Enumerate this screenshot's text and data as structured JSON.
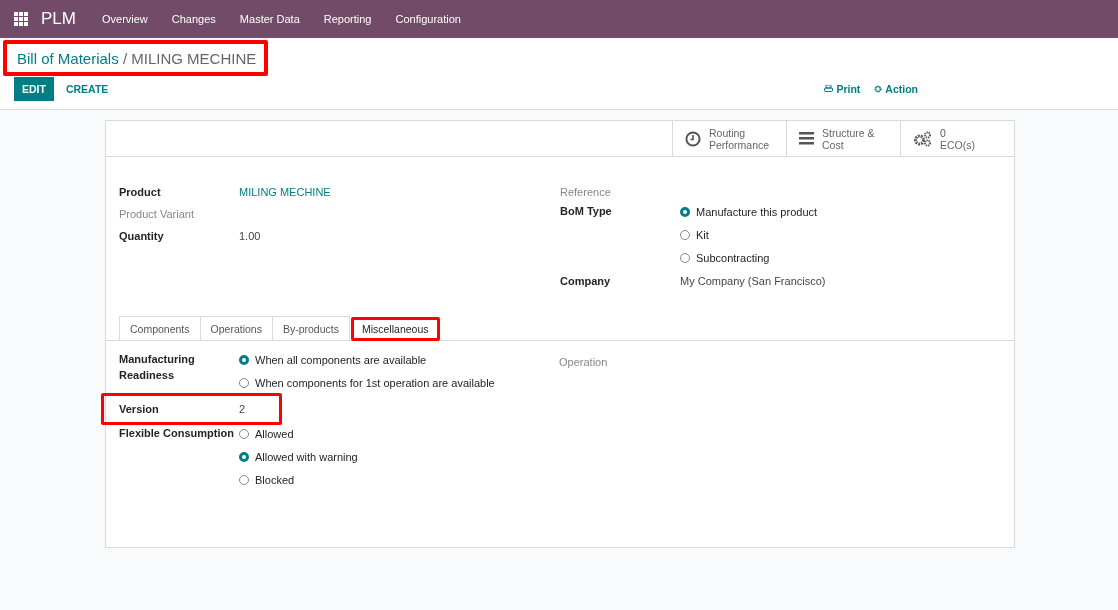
{
  "navbar": {
    "app": "PLM",
    "menu": [
      "Overview",
      "Changes",
      "Master Data",
      "Reporting",
      "Configuration"
    ]
  },
  "breadcrumb": {
    "parent": "Bill of Materials",
    "separator": "/",
    "current": "MILING MECHINE",
    "highlighted": true
  },
  "buttons": [
    {
      "label": "EDIT",
      "kind": "primary"
    },
    {
      "label": "CREATE",
      "kind": "link"
    }
  ],
  "actions": [
    {
      "label": "Print",
      "kind": "print"
    },
    {
      "label": "Action",
      "kind": "gear"
    }
  ],
  "smart_buttons": [
    {
      "kind": "clock",
      "lines": [
        "Routing",
        "Performance"
      ]
    },
    {
      "kind": "bars",
      "lines": [
        "Structure &",
        "Cost"
      ]
    },
    {
      "kind": "gears",
      "lines": [
        "0",
        "ECO(s)"
      ]
    }
  ],
  "left_fields": [
    {
      "label": "Product",
      "value": "MILING MECHINE",
      "kind": "link",
      "muted": false
    },
    {
      "label": "Product Variant",
      "muted": true
    },
    {
      "label": "Quantity",
      "value": "1.00",
      "kind": "text",
      "muted": false
    }
  ],
  "reference": {
    "label": "Reference"
  },
  "bom_type": {
    "label": "BoM Type",
    "options": [
      {
        "label": "Manufacture this product",
        "selected": true
      },
      {
        "label": "Kit",
        "selected": false
      },
      {
        "label": "Subcontracting",
        "selected": false
      }
    ]
  },
  "company": {
    "label": "Company",
    "value": "My Company (San Francisco)"
  },
  "tabs": [
    {
      "label": "Components",
      "selected": false,
      "highlighted": false
    },
    {
      "label": "Operations",
      "selected": false,
      "highlighted": false
    },
    {
      "label": "By-products",
      "selected": false,
      "highlighted": false
    },
    {
      "label": "Miscellaneous",
      "selected": true,
      "highlighted": true
    }
  ],
  "manufacturing_readiness": {
    "label": "Manufacturing Readiness",
    "options": [
      {
        "label": "When all components are available",
        "selected": true
      },
      {
        "label": "When components for 1st operation are available",
        "selected": false
      }
    ]
  },
  "version": {
    "label": "Version",
    "value": "2",
    "highlighted": true
  },
  "flexible_consumption": {
    "label": "Flexible Consumption",
    "options": [
      {
        "label": "Allowed",
        "selected": false
      },
      {
        "label": "Allowed with warning",
        "selected": true
      },
      {
        "label": "Blocked",
        "selected": false
      }
    ]
  },
  "operation": {
    "label": "Operation"
  }
}
